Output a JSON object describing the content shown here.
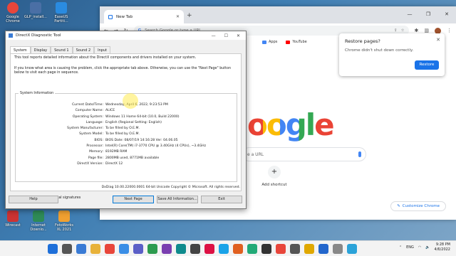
{
  "desktop": {
    "icons_top": [
      {
        "label": "Google Chrome",
        "color": "#e8463b"
      },
      {
        "label": "GLP_install...",
        "color": "#4a6fa5"
      },
      {
        "label": "EaseUS Partiti...",
        "color": "#2a8be0"
      }
    ],
    "icons_bottom": [
      {
        "label": "Wirecast",
        "color": "#c33"
      },
      {
        "label": "Internet Downlo...",
        "color": "#2e8b57"
      },
      {
        "label": "FotoWorks XL 2021",
        "color": "#f0a030"
      }
    ]
  },
  "chrome": {
    "tab_title": "New Tab",
    "omnibox_placeholder": "Search Google or type a URL",
    "bookmarks": [
      {
        "label": "Apps",
        "color": "#4285f4"
      },
      {
        "label": "YouTube",
        "color": "#ff0000"
      }
    ],
    "logo_text": "oogle",
    "search_placeholder": "e a URL",
    "shortcut_label": "Add shortcut",
    "customize_label": "Customize Chrome",
    "restore": {
      "title": "Restore pages?",
      "message": "Chrome didn't shut down correctly.",
      "button": "Restore"
    }
  },
  "dxdiag": {
    "title": "DirectX Diagnostic Tool",
    "tabs": [
      "System",
      "Display",
      "Sound 1",
      "Sound 2",
      "Input"
    ],
    "intro": "This tool reports detailed information about the DirectX components and drivers installed on your system.",
    "help": "If you know what area is causing the problem, click the appropriate tab above.  Otherwise, you can use the \"Next Page\" button below to visit each page in sequence.",
    "section_title": "System Information",
    "rows": [
      {
        "label": "Current Date/Time:",
        "value": "Wednesday, April 6, 2022, 9:23:53 PM"
      },
      {
        "label": "Computer Name:",
        "value": "ALICE"
      },
      {
        "label": "Operating System:",
        "value": "Windows 11 Home 64-bit (10.0, Build 22000)"
      },
      {
        "label": "Language:",
        "value": "English (Regional Setting: English)"
      },
      {
        "label": "System Manufacturer:",
        "value": "To be filled by O.E.M."
      },
      {
        "label": "System Model:",
        "value": "To be filled by O.E.M."
      },
      {
        "label": "BIOS:",
        "value": "BIOS Date: 08/07/19 14:16:28 Ver: 04.06.05"
      },
      {
        "label": "Processor:",
        "value": "Intel(R) Core(TM) i7-3770 CPU @ 3.40GHz (4 CPUs), ~3.4GHz"
      },
      {
        "label": "Memory:",
        "value": "8192MB RAM"
      },
      {
        "label": "Page file:",
        "value": "2800MB used, 8771MB available"
      },
      {
        "label": "DirectX Version:",
        "value": "DirectX 12"
      }
    ],
    "whql_label": "Check for WHQL digital signatures",
    "footer": "DxDiag 10.00.22000.0001 64-bit Unicode  Copyright © Microsoft. All rights reserved.",
    "buttons": {
      "help": "Help",
      "next": "Next Page",
      "save": "Save All Information...",
      "exit": "Exit"
    }
  },
  "taskbar": {
    "icon_colors": [
      "#1e6fd9",
      "#555",
      "#3a7bd5",
      "#e8b23a",
      "#e8463b",
      "#3a8ee6",
      "#5b5fc7",
      "#2d9b4f",
      "#7a3fb0",
      "#0f8b8d",
      "#444",
      "#d14",
      "#1aa3e8",
      "#e06020",
      "#2a7",
      "#333",
      "#e8463b",
      "#555",
      "#e0a800",
      "#2266cc",
      "#888",
      "#2ba3d9"
    ],
    "lang": "ENG",
    "time": "9:28 PM",
    "date": "4/6/2022"
  }
}
